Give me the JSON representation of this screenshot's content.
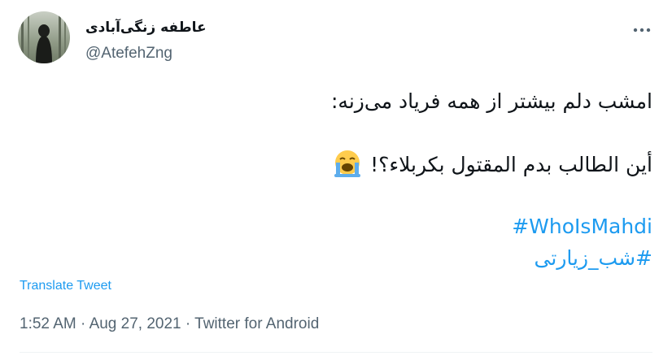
{
  "author": {
    "display_name": "عاطفه زنگی‌آبادی",
    "handle": "@AtefehZng"
  },
  "tweet": {
    "line1": "امشب دلم بیشتر از همه فریاد می‌زنه:",
    "line2": "أين الطالب بدم المقتول بكربلاء؟!",
    "emoji": "loudly-crying-face",
    "hashtags": [
      "#WhoIsMahdi",
      "#شب_زیارتی"
    ]
  },
  "translate_label": "Translate Tweet",
  "meta": {
    "time": "1:52 AM",
    "date": "Aug 27, 2021",
    "source": "Twitter for Android",
    "separator": "·"
  },
  "colors": {
    "link": "#1d9bf0",
    "secondary_text": "#536471",
    "primary_text": "#0f1419"
  }
}
